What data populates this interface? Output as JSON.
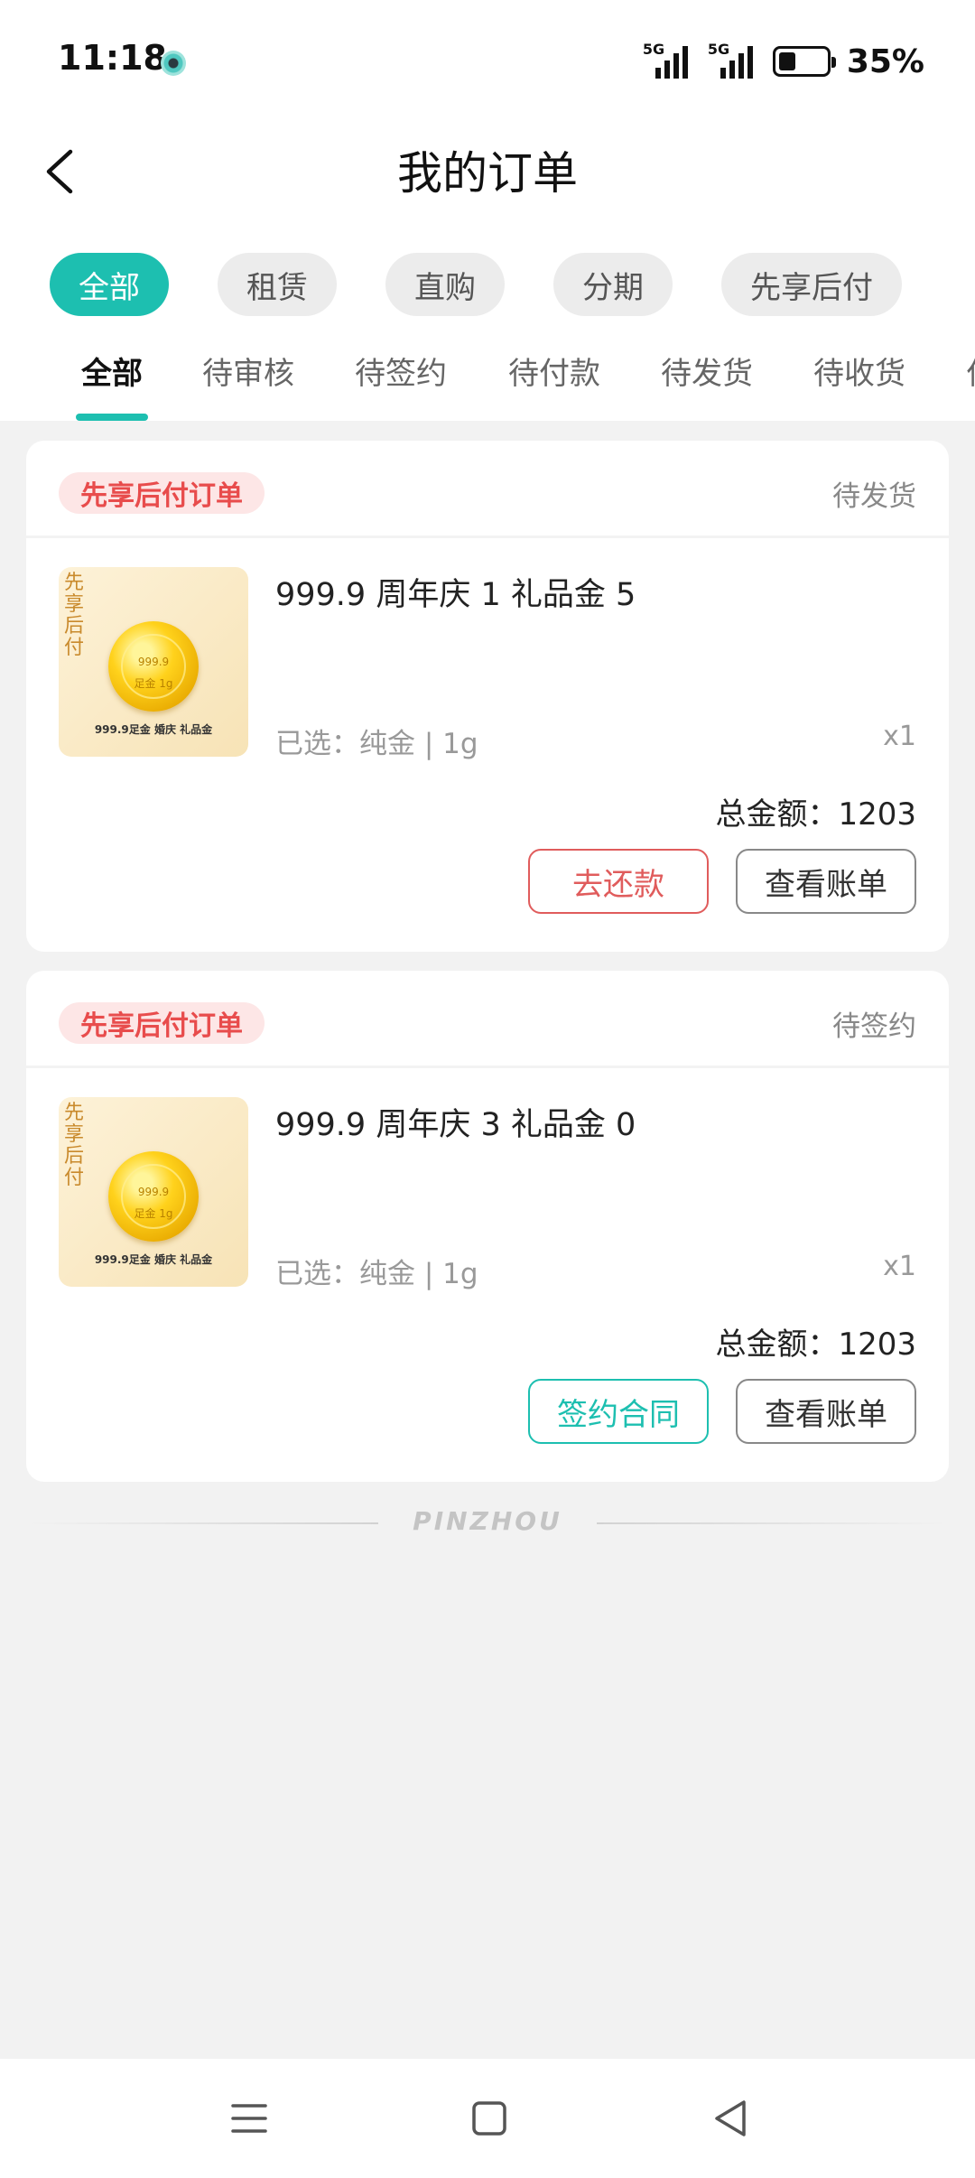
{
  "status_bar": {
    "time": "11:18",
    "network1": "5G",
    "network2": "5G",
    "battery_level": 0.35,
    "battery_text": "35%"
  },
  "header": {
    "title": "我的订单"
  },
  "type_filters": [
    {
      "label": "全部",
      "active": true
    },
    {
      "label": "租赁",
      "active": false
    },
    {
      "label": "直购",
      "active": false
    },
    {
      "label": "分期",
      "active": false
    },
    {
      "label": "先享后付",
      "active": false
    }
  ],
  "status_tabs": [
    {
      "label": "全部",
      "active": true
    },
    {
      "label": "待审核",
      "active": false
    },
    {
      "label": "待签约",
      "active": false
    },
    {
      "label": "待付款",
      "active": false
    },
    {
      "label": "待发货",
      "active": false
    },
    {
      "label": "待收货",
      "active": false
    },
    {
      "label": "付",
      "active": false
    }
  ],
  "orders": [
    {
      "type_badge": "先享后付订单",
      "status": "待发货",
      "product_name": "999.9 周年庆 1 礼品金 5",
      "spec": "已选：纯金 | 1g",
      "quantity": "x1",
      "total": "总金额：1203",
      "thumb": {
        "brand": "先享后付",
        "coin_line1": "999.9",
        "coin_line2": "足金 1g",
        "caption": "999.9足金 婚庆 礼品金"
      },
      "primary_action": {
        "label": "去还款",
        "style": "red"
      },
      "secondary_action": {
        "label": "查看账单"
      }
    },
    {
      "type_badge": "先享后付订单",
      "status": "待签约",
      "product_name": "999.9 周年庆 3 礼品金 0",
      "spec": "已选：纯金 | 1g",
      "quantity": "x1",
      "total": "总金额：1203",
      "thumb": {
        "brand": "先享后付",
        "coin_line1": "999.9",
        "coin_line2": "足金 1g",
        "caption": "999.9足金 婚庆 礼品金"
      },
      "primary_action": {
        "label": "签约合同",
        "style": "teal"
      },
      "secondary_action": {
        "label": "查看账单"
      }
    }
  ],
  "footer": {
    "brand": "PINZHOU"
  },
  "colors": {
    "accent": "#1dbfb0",
    "danger": "#e05c5c",
    "badge_bg": "#fde6e6",
    "background": "#f2f2f2"
  },
  "icons": {
    "back": "chevron-left-icon",
    "nav_menu": "menu-icon",
    "nav_home": "square-icon",
    "nav_back": "triangle-back-icon"
  }
}
